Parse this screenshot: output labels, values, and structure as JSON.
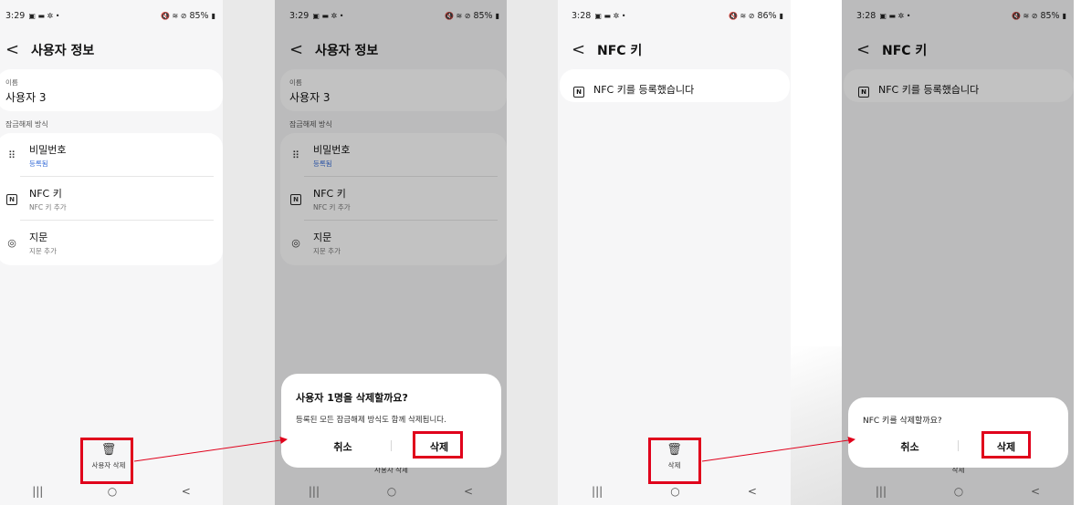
{
  "screens": [
    {
      "status": {
        "time": "3:29",
        "right": "85%"
      },
      "header": {
        "back": "<",
        "title": "사용자 정보"
      },
      "name_card": {
        "label": "이름",
        "value": "사용자 3"
      },
      "section": "잠금해제 방식",
      "methods": [
        {
          "label": "비밀번호",
          "sub": "등록됨",
          "icon": "dots-grid-icon",
          "sub_blue": true
        },
        {
          "label": "NFC 키",
          "sub": "NFC 키 추가",
          "icon": "nfc-icon"
        },
        {
          "label": "지문",
          "sub": "지문 추가",
          "icon": "fingerprint-icon"
        }
      ],
      "bottom_action": {
        "label": "사용자 삭제",
        "icon": "trash-icon"
      }
    },
    {
      "status": {
        "time": "3:29",
        "right": "85%"
      },
      "header": {
        "back": "<",
        "title": "사용자 정보"
      },
      "name_card": {
        "label": "이름",
        "value": "사용자 3"
      },
      "section": "잠금해제 방식",
      "methods": [
        {
          "label": "비밀번호",
          "sub": "등록됨",
          "icon": "dots-grid-icon",
          "sub_blue": true
        },
        {
          "label": "NFC 키",
          "sub": "NFC 키 추가",
          "icon": "nfc-icon"
        },
        {
          "label": "지문",
          "sub": "지문 추가",
          "icon": "fingerprint-icon"
        }
      ],
      "bottom_action": {
        "label": "사용자 삭제"
      },
      "dialog": {
        "title": "사용자 1명을 삭제할까요?",
        "body": "등록된 모든 잠금해제 방식도 함께 삭제됩니다.",
        "cancel": "취소",
        "confirm": "삭제"
      }
    },
    {
      "status": {
        "time": "3:28",
        "right": "86%"
      },
      "header": {
        "back": "<",
        "title": "NFC 키"
      },
      "nfc_item": {
        "label": "NFC 키를 등록했습니다",
        "icon": "nfc-icon"
      },
      "bottom_action": {
        "label": "삭제",
        "icon": "trash-icon"
      }
    },
    {
      "status": {
        "time": "3:28",
        "right": "85%"
      },
      "header": {
        "back": "<",
        "title": "NFC 키"
      },
      "nfc_item": {
        "label": "NFC 키를 등록했습니다",
        "icon": "nfc-icon"
      },
      "bottom_action": {
        "label": "삭제"
      },
      "dialog": {
        "title": "NFC 키를 삭제할까요?",
        "cancel": "취소",
        "confirm": "삭제"
      }
    }
  ],
  "navbar": {
    "recents": "|||",
    "home": "○",
    "back": "<"
  },
  "annotation": {
    "highlight_color": "#e0001b",
    "arrow_color": "#e0001b"
  }
}
